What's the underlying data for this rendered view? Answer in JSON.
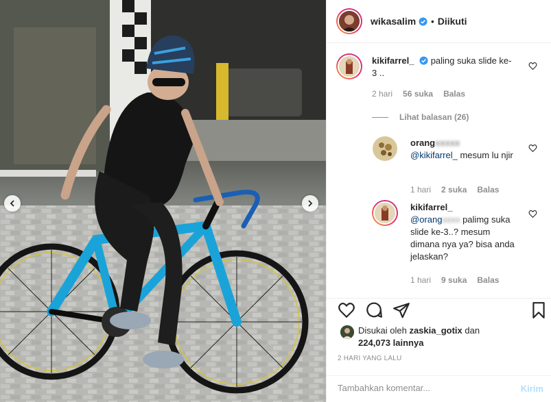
{
  "post": {
    "author": "wikasalim",
    "separator": "•",
    "follow_status": "Diikuti",
    "verified_icon": "verified-badge-icon"
  },
  "comments": [
    {
      "username": "kikifarrel_",
      "verified": true,
      "text": "paling suka slide ke-3 ..",
      "time": "2 hari",
      "likes": "56 suka",
      "reply_label": "Balas"
    }
  ],
  "view_replies": "Lihat balasan (26)",
  "replies": [
    {
      "username_visible": "orang",
      "mention": "@kikifarrel_",
      "text": "mesum lu njir",
      "time": "1 hari",
      "likes": "2 suka",
      "reply_label": "Balas"
    },
    {
      "username": "kikifarrel_",
      "mention_visible": "@orang",
      "text": "palimg suka slide ke-3..? mesum dimana nya ya? bisa anda jelaskan?",
      "time": "1 hari",
      "likes": "9 suka",
      "reply_label": "Balas"
    }
  ],
  "likes": {
    "prefix": "Disukai oleh",
    "user": "zaskia_gotix",
    "joiner": "dan",
    "count": "224,073",
    "suffix": "lainnya"
  },
  "date": "2 HARI YANG LALU",
  "composer": {
    "placeholder": "Tambahkan komentar...",
    "post_label": "Kirim"
  },
  "colors": {
    "link": "#00376b",
    "muted": "#8e8e8e",
    "post_disabled": "#b2dffc",
    "verified": "#3897f0",
    "bike_blue": "#1aa3d8"
  }
}
